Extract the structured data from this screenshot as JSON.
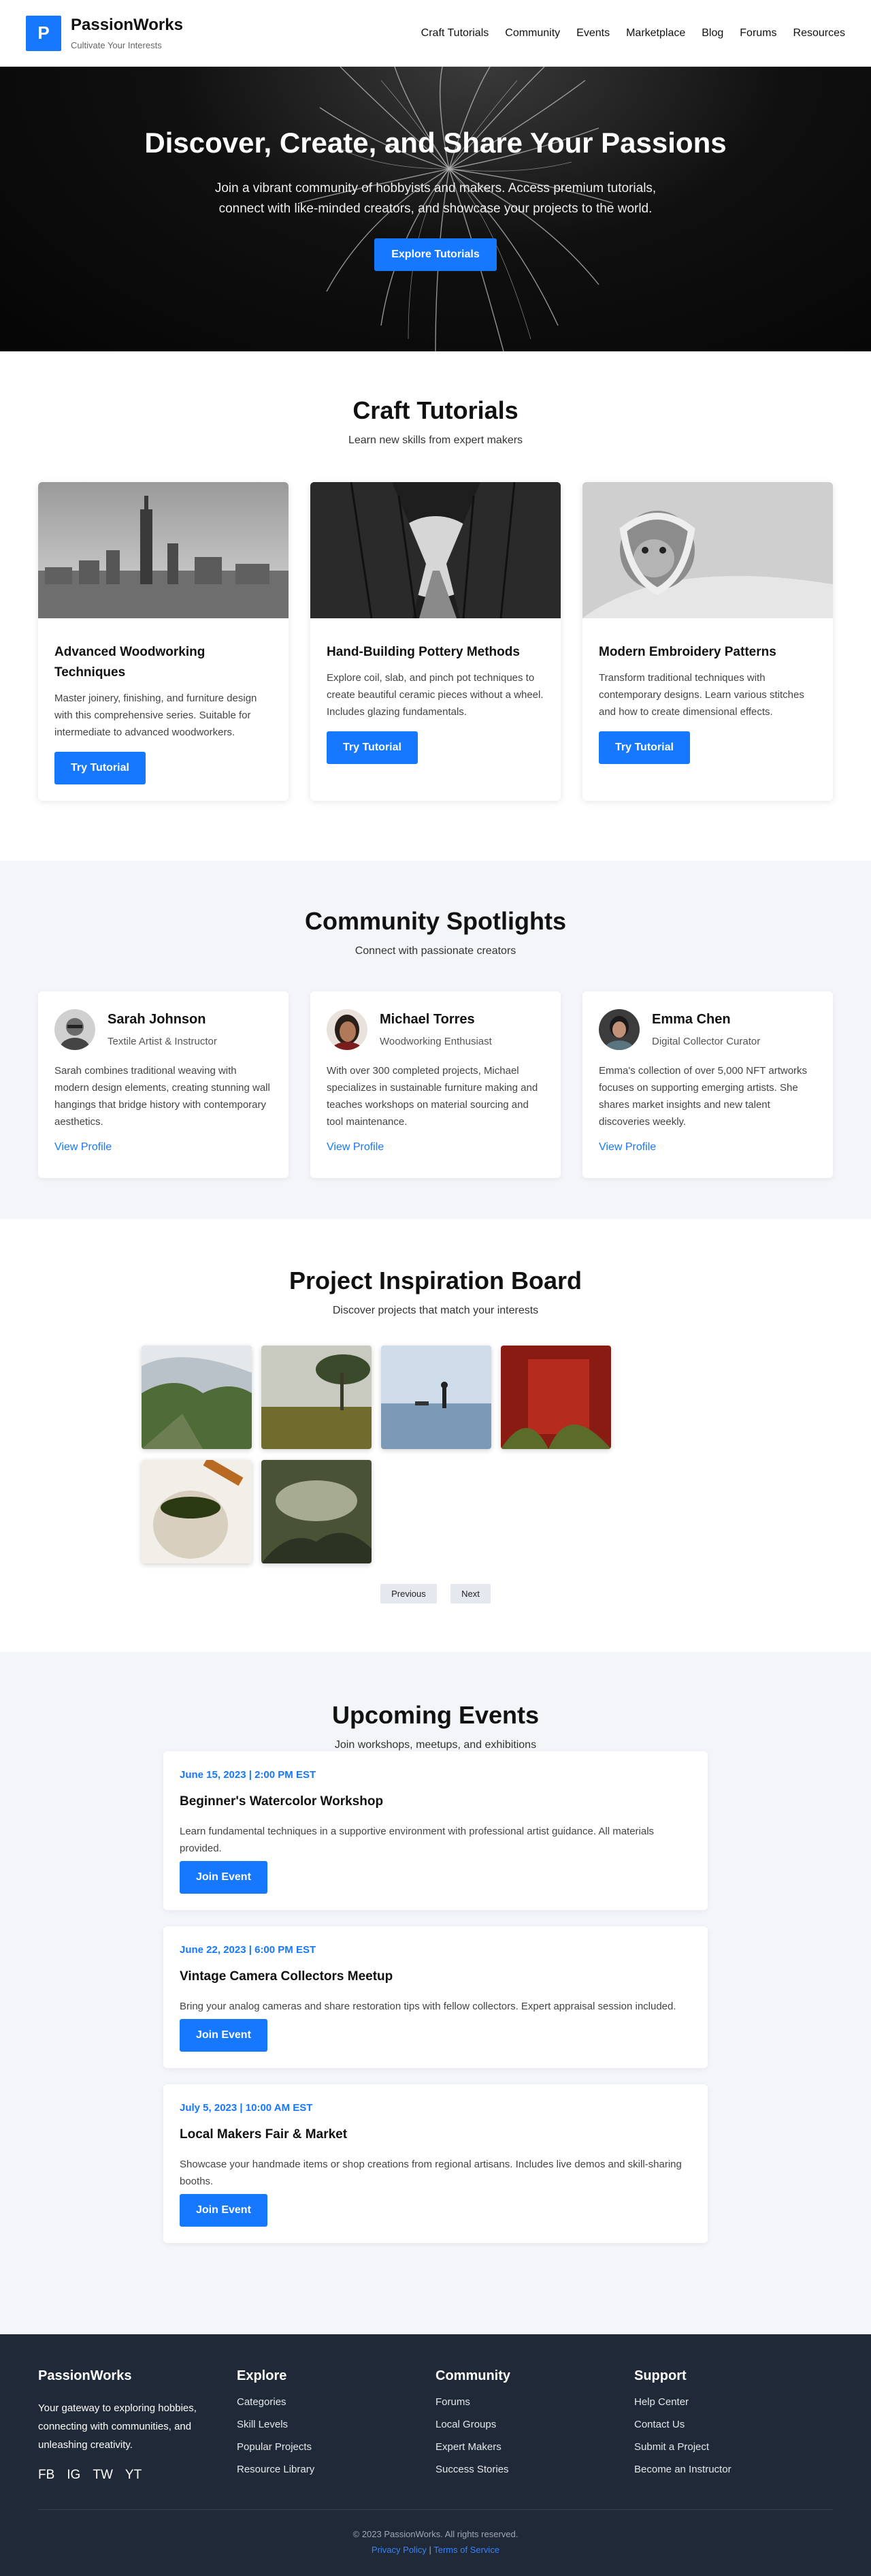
{
  "header": {
    "logo_letter": "P",
    "brand": "PassionWorks",
    "tagline": "Cultivate Your Interests",
    "nav": [
      "Craft Tutorials",
      "Community",
      "Events",
      "Marketplace",
      "Blog",
      "Forums",
      "Resources"
    ]
  },
  "hero": {
    "title": "Discover, Create, and Share Your Passions",
    "text": "Join a vibrant community of hobbyists and makers. Access premium tutorials, connect with like-minded creators, and showcase your projects to the world.",
    "cta": "Explore Tutorials"
  },
  "tutorials": {
    "title": "Craft Tutorials",
    "subtitle": "Learn new skills from expert makers",
    "items": [
      {
        "title": "Advanced Woodworking Techniques",
        "text": "Master joinery, finishing, and furniture design with this comprehensive series. Suitable for intermediate to advanced woodworkers.",
        "button": "Try Tutorial"
      },
      {
        "title": "Hand-Building Pottery Methods",
        "text": "Explore coil, slab, and pinch pot techniques to create beautiful ceramic pieces without a wheel. Includes glazing fundamentals.",
        "button": "Try Tutorial"
      },
      {
        "title": "Modern Embroidery Patterns",
        "text": "Transform traditional techniques with contemporary designs. Learn various stitches and how to create dimensional effects.",
        "button": "Try Tutorial"
      }
    ]
  },
  "community": {
    "title": "Community Spotlights",
    "subtitle": "Connect with passionate creators",
    "people": [
      {
        "name": "Sarah Johnson",
        "role": "Textile Artist & Instructor",
        "bio": "Sarah combines traditional weaving with modern design elements, creating stunning wall hangings that bridge history with contemporary aesthetics.",
        "link": "View Profile"
      },
      {
        "name": "Michael Torres",
        "role": "Woodworking Enthusiast",
        "bio": "With over 300 completed projects, Michael specializes in sustainable furniture making and teaches workshops on material sourcing and tool maintenance.",
        "link": "View Profile"
      },
      {
        "name": "Emma Chen",
        "role": "Digital Collector Curator",
        "bio": "Emma's collection of over 5,000 NFT artworks focuses on supporting emerging artists. She shares market insights and new talent discoveries weekly.",
        "link": "View Profile"
      }
    ]
  },
  "board": {
    "title": "Project Inspiration Board",
    "subtitle": "Discover projects that match your interests",
    "prev": "Previous",
    "next": "Next"
  },
  "events": {
    "title": "Upcoming Events",
    "subtitle": "Join workshops, meetups, and exhibitions",
    "items": [
      {
        "date": "June 15, 2023 | 2:00 PM EST",
        "title": "Beginner's Watercolor Workshop",
        "desc": "Learn fundamental techniques in a supportive environment with professional artist guidance. All materials provided.",
        "button": "Join Event"
      },
      {
        "date": "June 22, 2023 | 6:00 PM EST",
        "title": "Vintage Camera Collectors Meetup",
        "desc": "Bring your analog cameras and share restoration tips with fellow collectors. Expert appraisal session included.",
        "button": "Join Event"
      },
      {
        "date": "July 5, 2023 | 10:00 AM EST",
        "title": "Local Makers Fair & Market",
        "desc": "Showcase your handmade items or shop creations from regional artisans. Includes live demos and skill-sharing booths.",
        "button": "Join Event"
      }
    ]
  },
  "footer": {
    "brand": "PassionWorks",
    "about": "Your gateway to exploring hobbies, connecting with communities, and unleashing creativity.",
    "social": [
      "FB",
      "IG",
      "TW",
      "YT"
    ],
    "explore": {
      "title": "Explore",
      "links": [
        "Categories",
        "Skill Levels",
        "Popular Projects",
        "Resource Library"
      ]
    },
    "community": {
      "title": "Community",
      "links": [
        "Forums",
        "Local Groups",
        "Expert Makers",
        "Success Stories"
      ]
    },
    "support": {
      "title": "Support",
      "links": [
        "Help Center",
        "Contact Us",
        "Submit a Project",
        "Become an Instructor"
      ]
    },
    "copyright": "© 2023 PassionWorks. All rights reserved.",
    "privacy": "Privacy Policy",
    "separator": "|",
    "terms": "Terms of Service"
  }
}
